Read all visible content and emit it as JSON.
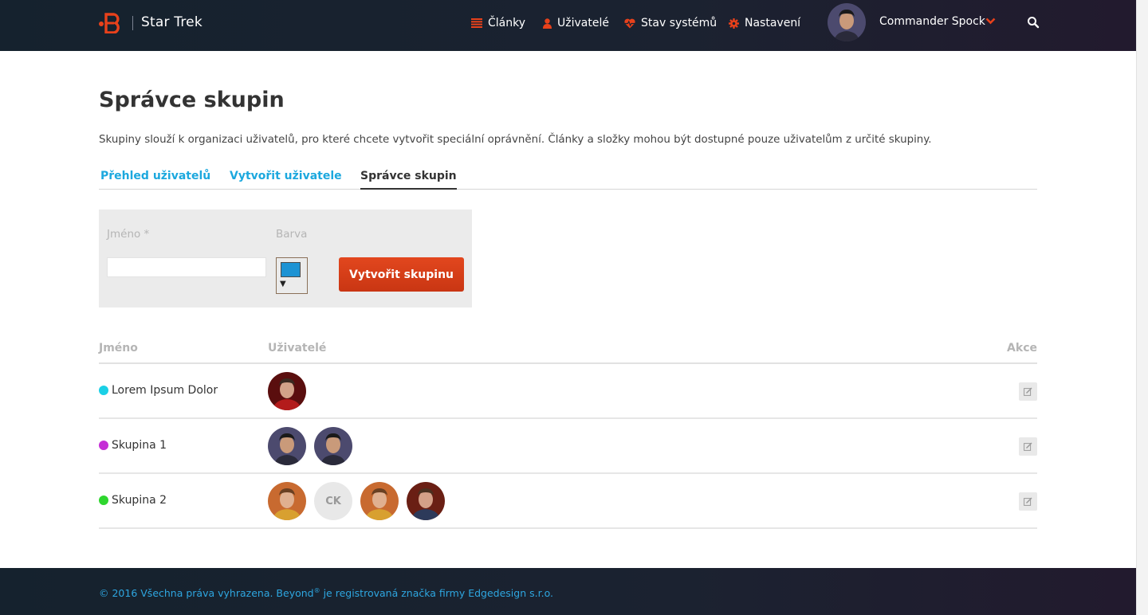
{
  "header": {
    "app_name": "Star Trek",
    "nav": [
      {
        "label": "Články",
        "icon": "list-icon"
      },
      {
        "label": "Uživatelé",
        "icon": "user-icon"
      },
      {
        "label": "Stav systémů",
        "icon": "heartbeat-icon"
      },
      {
        "label": "Nastavení",
        "icon": "gear-icon"
      }
    ],
    "user_name": "Commander Spock"
  },
  "page": {
    "title": "Správce skupin",
    "description": "Skupiny slouží k organizaci uživatelů, pro které chcete vytvořit speciální oprávnění. Články a složky mohou být dostupné pouze uživatelům z určité skupiny."
  },
  "tabs": [
    {
      "label": "Přehled uživatelů",
      "active": false
    },
    {
      "label": "Vytvořit uživatele",
      "active": false
    },
    {
      "label": "Správce skupin",
      "active": true
    }
  ],
  "form": {
    "name_label": "Jméno  *",
    "name_value": "",
    "color_label": "Barva",
    "color_value": "#1d93d4",
    "submit_label": "Vytvořit skupinu"
  },
  "table": {
    "headers": {
      "name": "Jméno",
      "users": "Uživatelé",
      "actions": "Akce"
    },
    "rows": [
      {
        "name": "Lorem Ipsum Dolor",
        "color": "#1ad0e6",
        "users": [
          "scotty"
        ]
      },
      {
        "name": "Skupina 1",
        "color": "#c52fd6",
        "users": [
          "spock",
          "spock"
        ]
      },
      {
        "name": "Skupina 2",
        "color": "#2ed62e",
        "users": [
          "kirk",
          "CK",
          "kirk",
          "mccoy"
        ]
      }
    ]
  },
  "footer": {
    "text_before": "© 2016 Všechna práva vyhrazena. Beyond",
    "sup": "®",
    "text_after": " je registrovaná značka firmy Edgedesign s.r.o."
  },
  "colors": {
    "accent": "#1ca8de",
    "primary_button": "#d63d17",
    "header_bg": "#1b2230"
  }
}
